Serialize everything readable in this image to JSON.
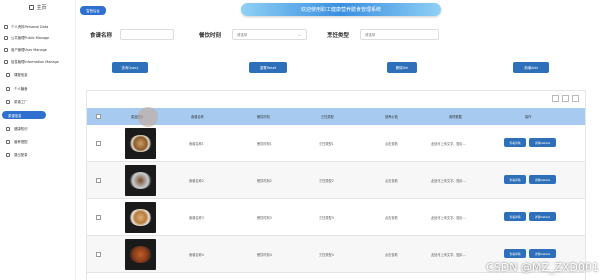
{
  "sidebar": {
    "home": "主页",
    "items": [
      {
        "label": "个人资料Personal Data"
      },
      {
        "label": "公共管理Public Manage"
      },
      {
        "label": "用户管理User Manage"
      },
      {
        "label": "信息管理Information Manage"
      }
    ],
    "subitems": [
      {
        "label": "课程信息"
      },
      {
        "label": "个人膳食"
      },
      {
        "label": "菜谱工厂"
      }
    ],
    "active": "菜谱信息",
    "after": [
      {
        "label": "健康知识"
      },
      {
        "label": "营养搭配"
      },
      {
        "label": "退出登录"
      }
    ]
  },
  "header": {
    "brand": "智慧后台",
    "title": "欢迎使用职工健康营养膳食管理系统"
  },
  "search": {
    "name_label": "食谱名称",
    "meal_label": "餐饮时刻",
    "meal_placeholder": "请选择",
    "cook_label": "烹饪类型",
    "cook_placeholder": "请选择"
  },
  "buttons": {
    "query": "查询Query",
    "reset": "重置Reset",
    "delete": "删除Del",
    "add": "新增Add"
  },
  "table": {
    "headers": [
      "菜品图片",
      "食谱名称",
      "餐饮时刻",
      "烹饪类型",
      "营养价值",
      "食材数据",
      "操作"
    ],
    "rows": [
      {
        "name": "食谱名称1",
        "meal": "餐饮时刻1",
        "cook": "烹饪类型1",
        "nutrition": "点击查看",
        "ingredients": "此处可上传文字、图片…"
      },
      {
        "name": "食谱名称2",
        "meal": "餐饮时刻2",
        "cook": "烹饪类型2",
        "nutrition": "点击查看",
        "ingredients": "此处可上传文字、图片…"
      },
      {
        "name": "食谱名称3",
        "meal": "餐饮时刻3",
        "cook": "烹饪类型3",
        "nutrition": "点击查看",
        "ingredients": "此处可上传文字、图片…"
      },
      {
        "name": "食谱名称4",
        "meal": "餐饮时刻4",
        "cook": "烹饪类型4",
        "nutrition": "点击查看",
        "ingredients": "此处可上传文字、图片…"
      }
    ],
    "view_btn": "查看详情",
    "edit_btn": "详情Details"
  },
  "watermark": "CSDN @MZ_ZXD001",
  "colors": {
    "accent": "#2f6fcf",
    "header_row": "#a6caf0",
    "button": "#2d6fb8"
  }
}
